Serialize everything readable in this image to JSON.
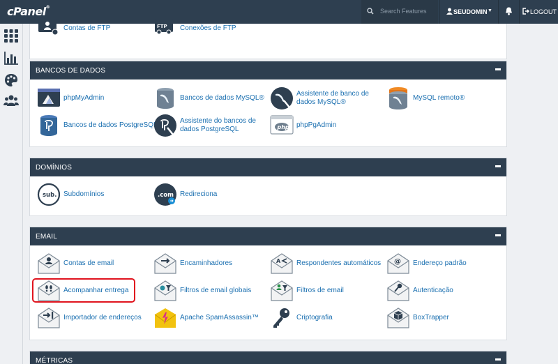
{
  "header": {
    "logo": "cPanel",
    "search_placeholder": "Search Features",
    "username": "SEUDOMIN",
    "logout": "LOGOUT"
  },
  "panels": {
    "top": {
      "items": [
        "Contas de FTP",
        "Conexões de FTP"
      ]
    },
    "databases": {
      "title": "BANCOS DE DADOS",
      "items": [
        "phpMyAdmin",
        "Bancos de dados MySQL®",
        "Assistente de banco de dados MySQL®",
        "MySQL remoto®",
        "Bancos de dados PostgreSQL",
        "Assistente do bancos de dados PostgreSQL",
        "phpPgAdmin"
      ]
    },
    "domains": {
      "title": "DOMÍNIOS",
      "items": [
        "Subdomínios",
        "Redireciona"
      ]
    },
    "email": {
      "title": "EMAIL",
      "items": [
        "Contas de email",
        "Encaminhadores",
        "Respondentes automáticos",
        "Endereço padrão",
        "Acompanhar entrega",
        "Filtros de email globais",
        "Filtros de email",
        "Autenticação",
        "Importador de endereços",
        "Apache SpamAssassin™",
        "Criptografia",
        "BoxTrapper"
      ]
    },
    "metrics": {
      "title": "MÉTRICAS"
    }
  },
  "icons": {
    "sub_label": "sub.",
    "com_label": ".com",
    "php_label": "php"
  },
  "colors": {
    "header_bg": "#2e3f50",
    "link": "#1a6fb0",
    "highlight": "#e0141e"
  }
}
